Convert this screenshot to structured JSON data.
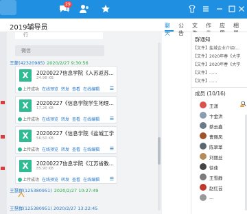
{
  "topbar": {
    "badge": "29"
  },
  "header": {
    "title": "2019辅导员",
    "tabs": [
      "聊天",
      "公告",
      "文件",
      "作业",
      "应用",
      "相册"
    ]
  },
  "chat": {
    "prev_fragment": "行",
    "prev_card": "微信",
    "sender": {
      "name": "王蒙(42320985)",
      "time": "2020/2/27 9:30:56"
    },
    "files": [
      {
        "name": "20200227信息学院《入苏返苏...",
        "size": "24.98 KB"
      },
      {
        "name": "20200227《信息学院学生地理...",
        "size": "17.26 KB"
      },
      {
        "name": "20200227《信息学院《盐城工学...",
        "size": "56.50 KB"
      },
      {
        "name": "20200227信息学院《江苏省教...",
        "size": "85.90 KB"
      }
    ],
    "file_actions": {
      "status": "上传成功",
      "preview": "在线预览",
      "forward": "转发",
      "view": "查看",
      "edit": "在线编辑"
    },
    "msg2": {
      "name": "王慧群(125380951)",
      "time": "2020/2/27 10:27:49"
    },
    "msg3": "王慧群(125380951) 2020/2/27 13:22:45"
  },
  "side": {
    "notice_title": "群通知",
    "notices": [
      "【文件】盐城企业介绍(...",
      "【文件】2020年春《大学...",
      "【文件】2020年春《大学...",
      "【文件】......",
      "【文件】......"
    ],
    "members_title": "成员 (10/16)",
    "members": [
      "王潇",
      "卞金洪",
      "蔡云鑫",
      "曹丽凤",
      "陈翠萃",
      "刘丽丝",
      "徐佳",
      "王雪静",
      "赵红芸",
      "..."
    ],
    "avatar_colors": [
      "#d9534f",
      "#8a9bb0",
      "#6c7a89",
      "#a0522d",
      "#5b6770",
      "#b58b5a",
      "#444",
      "#7d7d7d",
      "#c0392b",
      "#999"
    ]
  }
}
